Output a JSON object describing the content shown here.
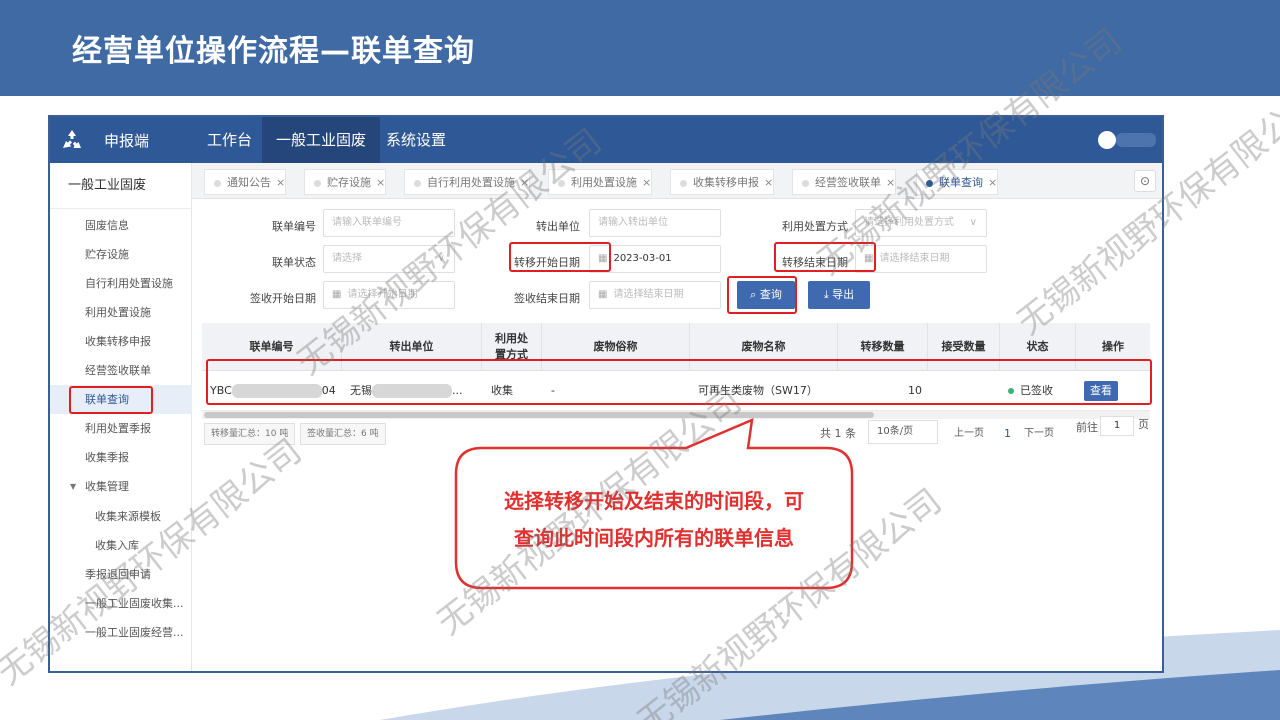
{
  "slide": {
    "title": "经营单位操作流程—联单查询"
  },
  "watermark": {
    "text": "无锡新视野环保有限公司"
  },
  "app": {
    "brand": "申报端",
    "nav": [
      "工作台",
      "一般工业固废",
      "系统设置"
    ],
    "active_nav": "一般工业固废"
  },
  "sidebar": {
    "title": "一般工业固废",
    "items": [
      "固废信息",
      "贮存设施",
      "自行利用处置设施",
      "利用处置设施",
      "收集转移申报",
      "经营签收联单",
      "联单查询",
      "利用处置季报",
      "收集季报",
      "收集管理",
      "收集来源模板",
      "收集入库",
      "季报退回申请",
      "一般工业固废收集...",
      "一般工业固废经营..."
    ],
    "active": "联单查询"
  },
  "tabs": [
    {
      "label": "通知公告",
      "close": "×"
    },
    {
      "label": "贮存设施",
      "close": "×"
    },
    {
      "label": "自行利用处置设施",
      "close": "×"
    },
    {
      "label": "利用处置设施",
      "close": "×"
    },
    {
      "label": "收集转移申报",
      "close": "×"
    },
    {
      "label": "经营签收联单",
      "close": "×"
    },
    {
      "label": "联单查询",
      "close": "×"
    }
  ],
  "filters": {
    "waybill_no": {
      "label": "联单编号",
      "placeholder": "请输入联单编号"
    },
    "from_unit": {
      "label": "转出单位",
      "placeholder": "请输入转出单位"
    },
    "method": {
      "label": "利用处置方式",
      "placeholder": "请选择利用处置方式"
    },
    "status": {
      "label": "联单状态",
      "placeholder": "请选择"
    },
    "transfer_start": {
      "label": "转移开始日期",
      "value": "2023-03-01"
    },
    "transfer_end": {
      "label": "转移结束日期",
      "placeholder": "请选择结束日期"
    },
    "sign_start": {
      "label": "签收开始日期",
      "placeholder": "请选择开始日期"
    },
    "sign_end": {
      "label": "签收结束日期",
      "placeholder": "请选择结束日期"
    },
    "query_button": "查询",
    "export_button": "导出"
  },
  "table": {
    "headers": [
      "联单编号",
      "转出单位",
      "利用处置方式",
      "废物俗称",
      "废物名称",
      "转移数量",
      "接受数量",
      "状态",
      "操作"
    ],
    "rows": [
      {
        "no_prefix": "YBC",
        "no_suffix": "04",
        "unit_prefix": "无锡",
        "unit_suffix": "...",
        "method": "收集",
        "common_name": "-",
        "name": "可再生类废物（SW17）",
        "qty": "10",
        "received": "",
        "status": "已签收",
        "action": "查看"
      }
    ]
  },
  "summary": {
    "transfer": "转移量汇总：10 吨",
    "receive": "签收量汇总：6 吨"
  },
  "pager": {
    "total": "共 1 条",
    "size": "10条/页",
    "prev": "上一页",
    "current": "1",
    "next": "下一页",
    "goto": "前往",
    "page": "1",
    "page_unit": "页"
  },
  "callout": {
    "line1": "选择转移开始及结束的时间段，可",
    "line2": "查询此时间段内所有的联单信息"
  },
  "colors": {
    "header_blue": "#3f6aa3",
    "nav_blue": "#2f5896",
    "highlight_red": "#e02020",
    "callout_red": "#e03030"
  }
}
